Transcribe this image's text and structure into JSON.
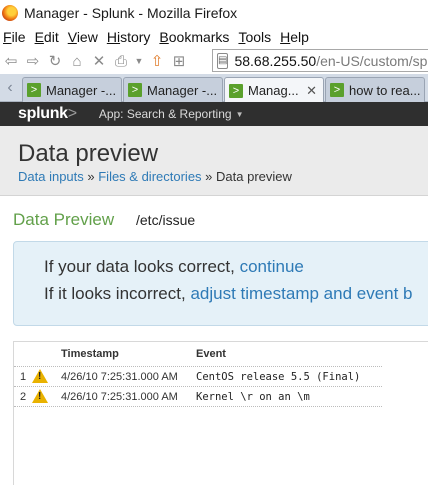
{
  "window": {
    "title": "Manager - Splunk - Mozilla Firefox"
  },
  "menubar": {
    "items": [
      {
        "underline": "F",
        "rest": "ile"
      },
      {
        "underline": "E",
        "rest": "dit"
      },
      {
        "underline": "V",
        "rest": "iew"
      },
      {
        "underline": "Hi",
        "rest": "story",
        "underline_first": false
      },
      {
        "underline": "B",
        "rest": "ookmarks"
      },
      {
        "underline": "T",
        "rest": "ools"
      },
      {
        "underline": "H",
        "rest": "elp"
      }
    ]
  },
  "urlbar": {
    "host": "58.68.255.50",
    "path": "/en-US/custom/splun"
  },
  "tabs": [
    {
      "label": "Manager -...",
      "favicon": ">"
    },
    {
      "label": "Manager -...",
      "favicon": ">"
    },
    {
      "label": "Manag...",
      "favicon": ">",
      "close": "✕"
    },
    {
      "label": "how to rea...",
      "favicon": ">"
    }
  ],
  "splunk": {
    "logo_text": "splunk",
    "logo_gt": ">",
    "app_menu": "App: Search & Reporting"
  },
  "page": {
    "title": "Data preview",
    "breadcrumb": {
      "item1": "Data inputs",
      "sep": " » ",
      "item2": "Files & directories",
      "current": "Data preview"
    }
  },
  "preview": {
    "heading": "Data Preview",
    "file": "/etc/issue",
    "notice": {
      "line1_text": "If your data looks correct, ",
      "line1_link": "continue",
      "line2_text": "If it looks incorrect, ",
      "line2_link": "adjust timestamp and event b"
    },
    "columns": {
      "timestamp": "Timestamp",
      "event": "Event"
    },
    "rows": [
      {
        "num": "1",
        "timestamp": "4/26/10 7:25:31.000 AM",
        "event": "CentOS release 5.5 (Final)"
      },
      {
        "num": "2",
        "timestamp": "4/26/10 7:25:31.000 AM",
        "event": "Kernel \\r on an \\m"
      }
    ]
  },
  "colors": {
    "splunk_bar": "#2f2f2f",
    "link": "#2e7ab6",
    "section_green": "#62a04a",
    "notice_bg": "#e5f1f8",
    "warning": "#e9b200"
  }
}
